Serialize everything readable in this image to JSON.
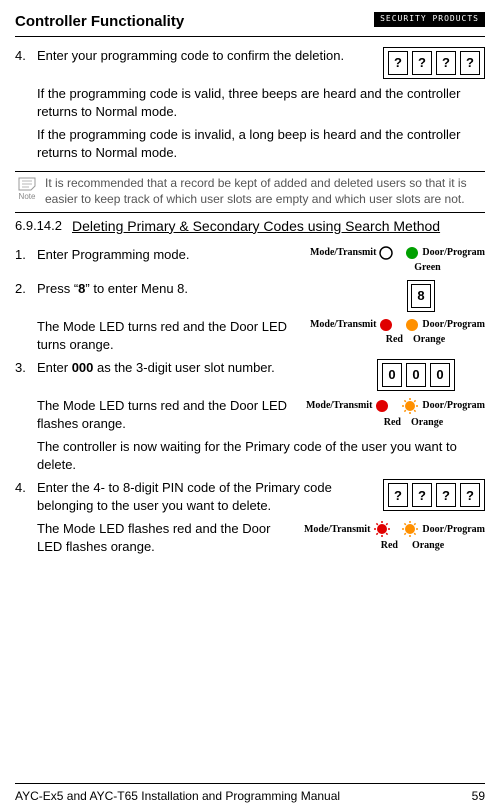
{
  "header": {
    "title": "Controller Functionality",
    "brand": "SECURITY PRODUCTS"
  },
  "step4a": {
    "num": "4.",
    "text": "Enter your programming code to confirm the deletion.",
    "keys": [
      "?",
      "?",
      "?",
      "?"
    ],
    "para1": "If the programming code is valid, three beeps are heard and the controller returns to Normal mode.",
    "para2": "If the programming code is invalid, a long beep is heard and the controller returns to Normal mode."
  },
  "note": {
    "label": "Note",
    "text": "It is recommended that a record be kept of added and deleted users so that it is easier to keep track of which user slots are empty and which user slots are not."
  },
  "section": {
    "num": "6.9.14.2",
    "title": "Deleting Primary & Secondary Codes using Search Method"
  },
  "step1": {
    "num": "1.",
    "text": "Enter Programming mode.",
    "led_left": "Mode/Transmit",
    "led_right": "Door/Program",
    "right_sub": "Green"
  },
  "step2": {
    "num": "2.",
    "text_pre": "Press “",
    "key": "8",
    "text_post": "” to enter Menu 8.",
    "keybox": "8",
    "para": "The Mode LED turns red and the Door LED turns orange.",
    "led_left": "Mode/Transmit",
    "led_right": "Door/Program",
    "left_sub": "Red",
    "right_sub": "Orange"
  },
  "step3": {
    "num": "3.",
    "text_pre": "Enter ",
    "code": "000",
    "text_post": " as the 3-digit user slot number.",
    "keys": [
      "0",
      "0",
      "0"
    ],
    "para1": "The Mode LED turns red and the Door LED flashes orange.",
    "led_left": "Mode/Transmit",
    "led_right": "Door/Program",
    "left_sub": "Red",
    "right_sub": "Orange",
    "para2": "The controller is now waiting for the Primary code of the user you want to delete."
  },
  "step4b": {
    "num": "4.",
    "text": "Enter the 4- to 8-digit PIN code of the Primary code belonging to the user you want to delete.",
    "keys": [
      "?",
      "?",
      "?",
      "?"
    ],
    "para": "The Mode LED flashes red and the Door LED flashes orange.",
    "led_left": "Mode/Transmit",
    "led_right": "Door/Program",
    "left_sub": "Red",
    "right_sub": "Orange"
  },
  "footer": {
    "text": "AYC-Ex5 and AYC-T65 Installation and Programming Manual",
    "page": "59"
  },
  "colors": {
    "green": "#00a000",
    "red": "#e00000",
    "orange": "#ff9000"
  }
}
